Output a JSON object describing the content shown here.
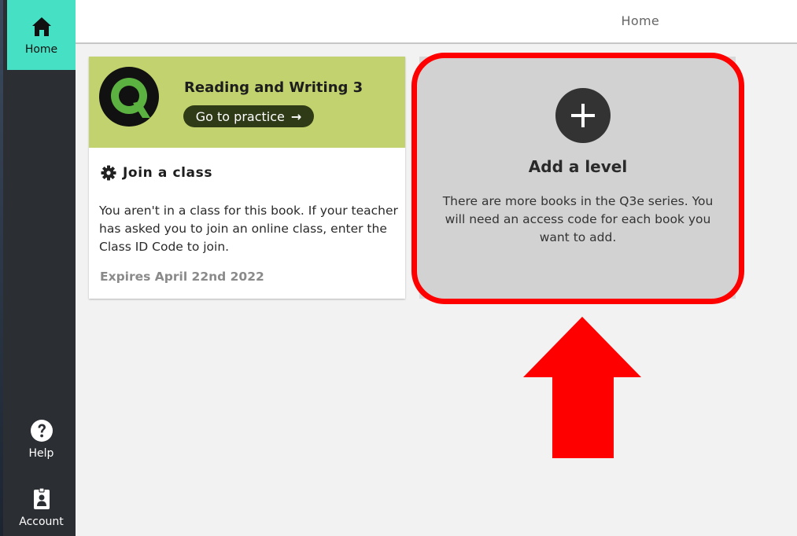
{
  "sidebar": {
    "items": [
      {
        "label": "Home",
        "icon": "home-icon"
      },
      {
        "label": "Help",
        "icon": "help-icon"
      },
      {
        "label": "Account",
        "icon": "account-icon"
      }
    ],
    "accent_color": "#46e0c4"
  },
  "topbar": {
    "title": "Home"
  },
  "book_card": {
    "title": "Reading and Writing 3",
    "practice_label": "Go to practice",
    "practice_icon": "arrow-right-icon",
    "header_color": "#c2d26e",
    "join_label": "Join a class",
    "join_description": "You aren't in a class for this book. If your teacher has asked you to join an online class, enter the Class ID Code to join.",
    "expires": "Expires April 22nd 2022"
  },
  "add_level": {
    "icon": "plus-icon",
    "title": "Add a level",
    "description": "There are more books in the Q3e series. You will need an access code for each book you want to add.",
    "highlight_color": "#ff0000"
  },
  "annotation": {
    "arrow_color": "#ff0000"
  }
}
